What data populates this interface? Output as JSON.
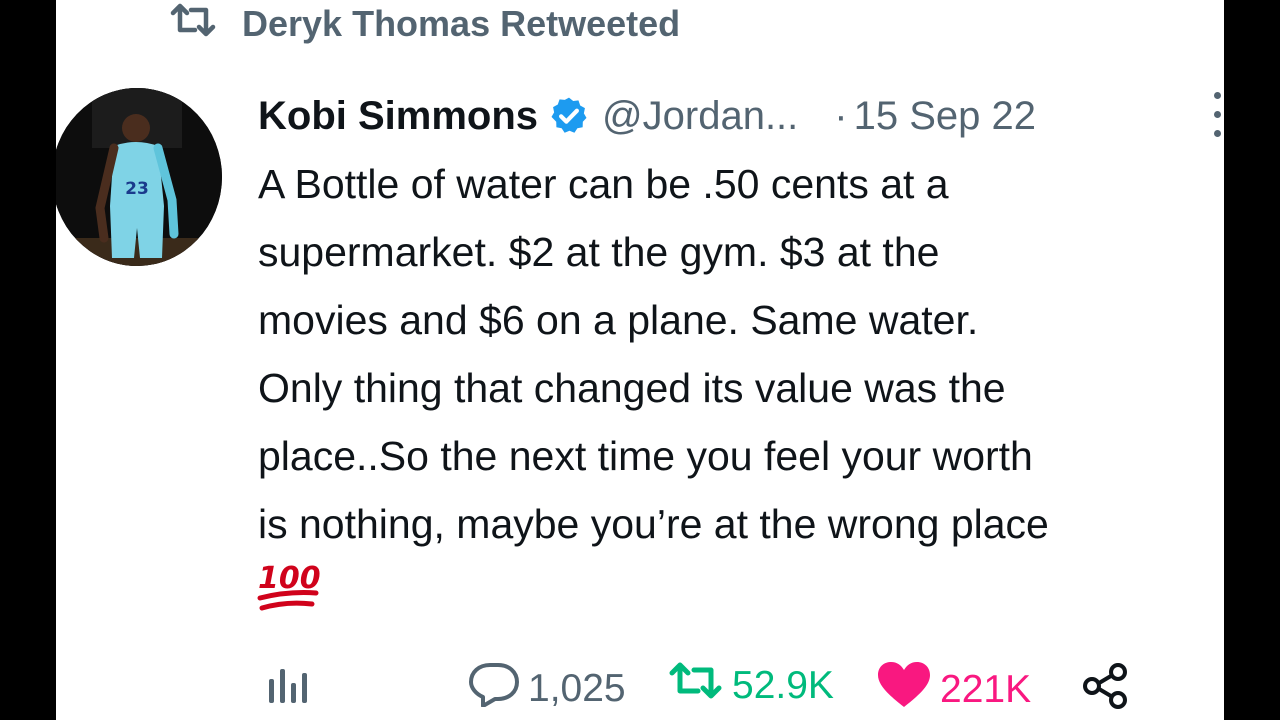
{
  "social_context": {
    "text": "Deryk Thomas Retweeted",
    "icon": "retweet-icon"
  },
  "author": {
    "name": "Kobi Simmons",
    "handle": "@Jordan...",
    "date": "15 Sep 22",
    "separator": "·",
    "verified_color": "#1d9bf0",
    "jersey_number": "23"
  },
  "tweet": {
    "text": "A Bottle of water can be .50 cents at a\nsupermarket. $2 at the gym. $3 at the\nmovies and $6 on a plane. Same water.\nOnly thing that changed its value was the\nplace..So the next time you feel your worth\nis nothing, maybe you’re at the wrong place",
    "emoji_label": "100"
  },
  "actions": {
    "views_icon": "views-icon",
    "replies": "1,025",
    "retweets": "52.9K",
    "likes": "221K",
    "share_icon": "share-icon"
  },
  "colors": {
    "retweet_green": "#00ba7c",
    "like_pink": "#f91880",
    "muted": "#536471",
    "emoji_red": "#d0021b"
  }
}
